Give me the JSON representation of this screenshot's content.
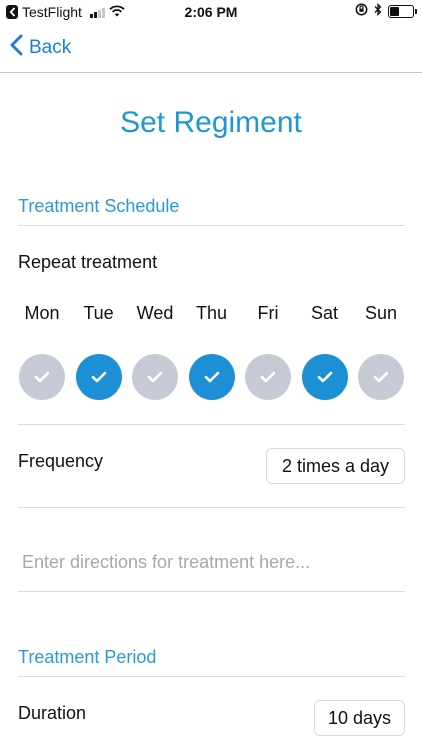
{
  "status_bar": {
    "carrier": "TestFlight",
    "time": "2:06 PM",
    "signal_bars_filled": 2,
    "signal_bars_total": 4,
    "battery_level": 0.45
  },
  "nav": {
    "back_label": "Back"
  },
  "page": {
    "title": "Set Regiment"
  },
  "schedule": {
    "section_title": "Treatment Schedule",
    "repeat_label": "Repeat treatment",
    "days": [
      {
        "name": "Mon",
        "checked": false
      },
      {
        "name": "Tue",
        "checked": true
      },
      {
        "name": "Wed",
        "checked": false
      },
      {
        "name": "Thu",
        "checked": true
      },
      {
        "name": "Fri",
        "checked": false
      },
      {
        "name": "Sat",
        "checked": true
      },
      {
        "name": "Sun",
        "checked": false
      }
    ],
    "frequency_label": "Frequency",
    "frequency_value": "2 times a day",
    "directions_placeholder": "Enter directions for treatment here..."
  },
  "period": {
    "section_title": "Treatment Period",
    "duration_label": "Duration",
    "duration_value": "10 days"
  },
  "colors": {
    "accent": "#1d8fd4",
    "unchecked": "#c5cad4",
    "section_text": "#2a9ad6"
  }
}
